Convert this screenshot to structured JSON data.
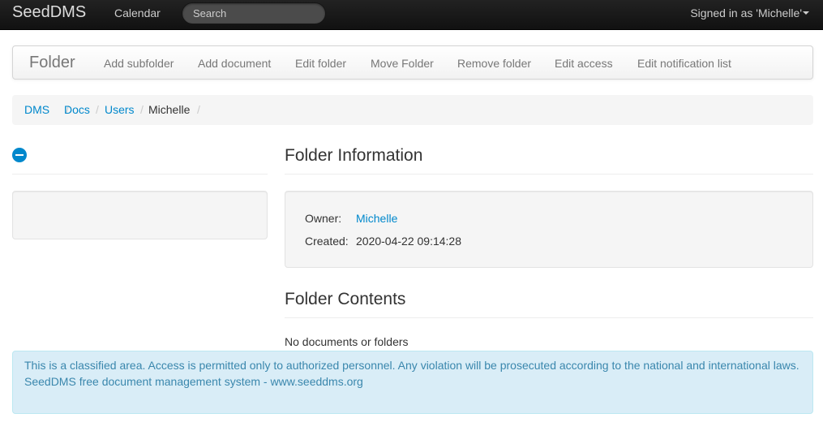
{
  "navbar": {
    "brand": "SeedDMS",
    "calendar": "Calendar",
    "search_placeholder": "Search",
    "signed_in": "Signed in as 'Michelle'"
  },
  "subnav": {
    "title": "Folder",
    "links": [
      "Add subfolder",
      "Add document",
      "Edit folder",
      "Move Folder",
      "Remove folder",
      "Edit access",
      "Edit notification list"
    ]
  },
  "breadcrumb": [
    "DMS",
    "Docs",
    "Users",
    "Michelle"
  ],
  "folder_info": {
    "heading": "Folder Information",
    "owner_label": "Owner:",
    "owner_value": "Michelle",
    "created_label": "Created:",
    "created_value": "2020-04-22 09:14:28"
  },
  "folder_contents": {
    "heading": "Folder Contents",
    "empty_text": "No documents or folders"
  },
  "footer": {
    "notice": "This is a classified area. Access is permitted only to authorized personnel. Any violation will be prosecuted according to the national and international laws.",
    "tagline": "SeedDMS free document management system - www.seeddms.org"
  },
  "colors": {
    "link": "#0088cc",
    "navbar_bg": "#1b1b1b",
    "alert_bg": "#d9edf7",
    "alert_text": "#3a87ad"
  }
}
